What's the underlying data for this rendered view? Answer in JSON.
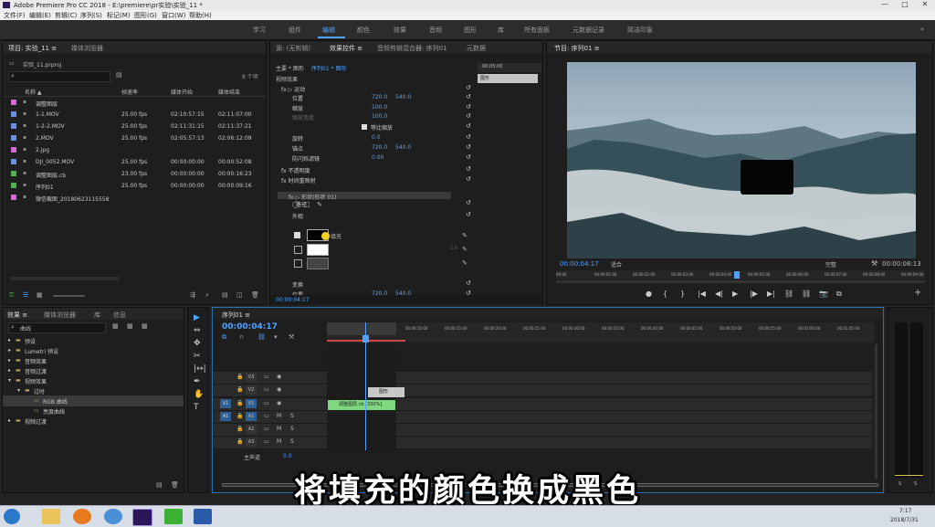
{
  "window": {
    "title": "Adobe Premiere Pro CC 2018 - E:\\premiere\\pr实验\\实验_11 *",
    "controls": [
      "—",
      "□",
      "✕"
    ]
  },
  "menu": [
    "文件(F)",
    "编辑(E)",
    "剪辑(C)",
    "序列(S)",
    "标记(M)",
    "图形(G)",
    "窗口(W)",
    "帮助(H)"
  ],
  "workspaces": [
    {
      "label": "学习",
      "active": false
    },
    {
      "label": "组件",
      "active": false
    },
    {
      "label": "编辑",
      "active": true
    },
    {
      "label": "颜色",
      "active": false
    },
    {
      "label": "效果",
      "active": false
    },
    {
      "label": "音频",
      "active": false
    },
    {
      "label": "图形",
      "active": false
    },
    {
      "label": "库",
      "active": false
    },
    {
      "label": "所有面板",
      "active": false
    },
    {
      "label": "元数据记录",
      "active": false
    },
    {
      "label": "简洁印象",
      "active": false
    }
  ],
  "project": {
    "tab": "项目: 实验_11 ≡",
    "tab2": "媒体浏览器",
    "file": "实验_11.prproj",
    "count": "8 个项",
    "headers": [
      "名称 ▲",
      "帧速率",
      "媒体开始",
      "媒体结束"
    ],
    "items": [
      {
        "name": "调整图层",
        "color": "#d36ad6",
        "fps": "",
        "start": "",
        "end": ""
      },
      {
        "name": "1-1.MOV",
        "color": "#6d8fe0",
        "fps": "25.00 fps",
        "start": "02:10:57:15",
        "end": "02:11:07:00"
      },
      {
        "name": "1-2-2.MOV",
        "color": "#6d8fe0",
        "fps": "25.00 fps",
        "start": "02:11:31:15",
        "end": "02:11:37:21"
      },
      {
        "name": "2.MOV",
        "color": "#6d8fe0",
        "fps": "25.00 fps",
        "start": "02:05:57:13",
        "end": "02:06:12:09"
      },
      {
        "name": "2.jpg",
        "color": "#d36ad6",
        "fps": "",
        "start": "",
        "end": ""
      },
      {
        "name": "DJI_0052.MOV",
        "color": "#6d8fe0",
        "fps": "25.00 fps",
        "start": "00:00:00:00",
        "end": "00:00:52:08"
      },
      {
        "name": "调整图层.cb",
        "color": "#52b052",
        "fps": "23.00 fps",
        "start": "00:00:00:00",
        "end": "00:00:16:23"
      },
      {
        "name": "序列01",
        "color": "#52b052",
        "fps": "25.00 fps",
        "start": "00:00:00:00",
        "end": "00:00:09:16"
      },
      {
        "name": "微信截图_20180623115558",
        "color": "#d36ad6",
        "fps": "",
        "start": "",
        "end": ""
      }
    ]
  },
  "effect_controls": {
    "tabs": [
      "源: (无剪辑)",
      "效果控件 ≡",
      "音频剪辑混合器: 序列01",
      "元数据"
    ],
    "master": "主要 * 图形",
    "seq": "序列01 * 图形",
    "section_video": "视频效果",
    "time_ruler": "00:05:00",
    "clip_label": "图形",
    "rows": [
      {
        "label": "fx ▷ 运动",
        "v1": "",
        "v2": ""
      },
      {
        "label": "位置",
        "v1": "720.0",
        "v2": "540.0"
      },
      {
        "label": "缩放",
        "v1": "100.0",
        "v2": ""
      },
      {
        "label": "缩放宽度",
        "v1": "100.0",
        "v2": ""
      },
      {
        "label": "等比缩放",
        "v1": "",
        "v2": ""
      },
      {
        "label": "旋转",
        "v1": "0.0",
        "v2": ""
      },
      {
        "label": "锚点",
        "v1": "720.0",
        "v2": "540.0"
      },
      {
        "label": "防闪烁滤镜",
        "v1": "0.00",
        "v2": ""
      },
      {
        "label": "fx 不透明度",
        "v1": "",
        "v2": ""
      },
      {
        "label": "fx 时间重映射",
        "v1": "",
        "v2": ""
      },
      {
        "label": "fx ▷ 形状(形状 01)",
        "v1": "",
        "v2": ""
      },
      {
        "label": "路径",
        "v1": "",
        "v2": ""
      },
      {
        "label": "外观",
        "v1": "",
        "v2": ""
      },
      {
        "label": "填充",
        "v1": "",
        "v2": ""
      },
      {
        "label": "描边",
        "v1": "",
        "v2": ""
      },
      {
        "label": "阴影",
        "v1": "",
        "v2": ""
      },
      {
        "label": "变换",
        "v1": "",
        "v2": ""
      },
      {
        "label": "位置",
        "v1": "720.0",
        "v2": "540.0"
      }
    ],
    "fill_label": "填充",
    "stroke_val": "1.0",
    "timecode": "00:00:04:17"
  },
  "program": {
    "tab": "节目: 序列01 ≡",
    "timecode": "00:00:04:17",
    "fit": "适合",
    "quality": "完整",
    "duration": "00:00:08:13",
    "ruler": [
      "00:00",
      "00:00:01:00",
      "00:00:02:00",
      "00:00:03:00",
      "00:00:04:00",
      "00:00:05:00",
      "00:00:06:00",
      "00:00:07:00",
      "00:00:08:00",
      "00:00:09:00"
    ],
    "transport": [
      "●",
      "{",
      "}",
      "|◀",
      "◀|",
      "▶",
      "|▶",
      "▶|",
      "⛓",
      "⛓",
      "📷",
      "⧉"
    ],
    "add": "+"
  },
  "effects_panel": {
    "tabs": [
      "效果 ≡",
      "媒体浏览器",
      "库",
      "信息"
    ],
    "search": "曲线",
    "tree": [
      {
        "label": "预设",
        "indent": 0
      },
      {
        "label": "Lumetri 预设",
        "indent": 0
      },
      {
        "label": "音频效果",
        "indent": 0
      },
      {
        "label": "音频过渡",
        "indent": 0
      },
      {
        "label": "视频效果",
        "indent": 0
      },
      {
        "label": "过时",
        "indent": 1
      },
      {
        "label": "RGB 曲线",
        "indent": 2
      },
      {
        "label": "亮度曲线",
        "indent": 2
      },
      {
        "label": "视频过渡",
        "indent": 0
      }
    ]
  },
  "tools": [
    "▶",
    "⇔",
    "✥",
    "✂",
    "|↔|",
    "✒",
    "✋",
    "T"
  ],
  "timeline": {
    "tab": "序列01 ≡",
    "timecode": "00:00:04:17",
    "ruler": [
      ":00:00",
      "00:00:05:00",
      "00:00:10:00",
      "00:00:15:00",
      "00:00:20:00",
      "00:00:25:00",
      "00:00:30:00",
      "00:00:35:00",
      "00:00:40:00",
      "00:00:45:00",
      "00:00:50:00",
      "00:00:55:00",
      "00:01:00:00",
      "00:01:05:00"
    ],
    "tracks": [
      {
        "name": "V3",
        "src": ""
      },
      {
        "name": "V2",
        "src": ""
      },
      {
        "name": "V1",
        "src": "V1"
      },
      {
        "name": "A1",
        "src": "A1"
      },
      {
        "name": "A2",
        "src": ""
      },
      {
        "name": "A3",
        "src": ""
      }
    ],
    "master": "主声道",
    "master_val": "0.0",
    "clips": {
      "graphic": "图形",
      "video": "调整图层.cb [200%]"
    },
    "meter_labels": [
      "S",
      "S"
    ]
  },
  "subtitle": "将填充的颜色换成黑色",
  "taskbar": {
    "time": "7:17",
    "date": "2018/7/31"
  }
}
